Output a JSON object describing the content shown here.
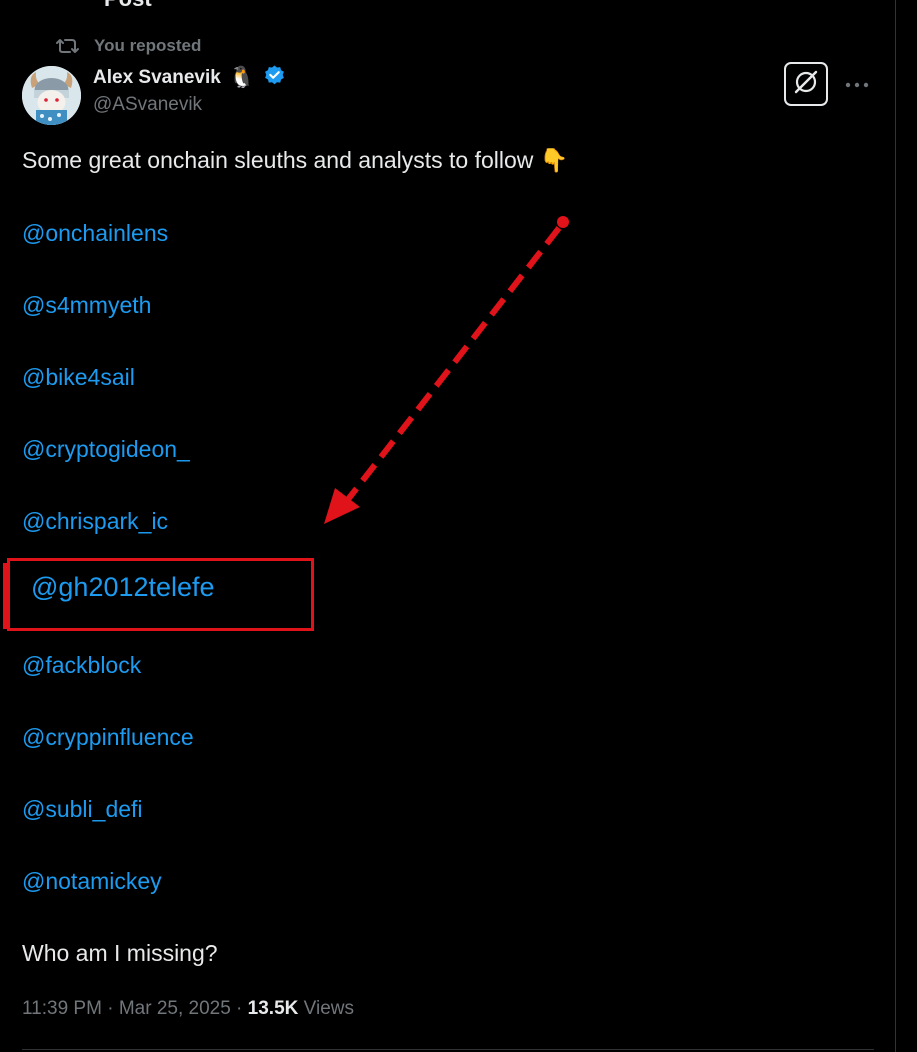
{
  "header": {
    "title": "Post"
  },
  "repost": {
    "label": "You reposted",
    "icon": "repost-icon"
  },
  "author": {
    "display_name": "Alex Svanevik",
    "emoji": "🐧",
    "verified": true,
    "handle": "@ASvanevik"
  },
  "actions": {
    "grok_icon": "grok-icon",
    "more_icon": "more-horizontal-icon"
  },
  "tweet": {
    "intro": "Some great onchain sleuths and analysts to follow 👇",
    "mentions": [
      "@onchainlens",
      "@s4mmyeth",
      "@bike4sail",
      "@cryptogideon_",
      "@chrispark_ic",
      "@gh2012telefe",
      "@fackblock",
      "@cryppinfluence",
      "@subli_defi",
      "@notamickey"
    ],
    "outro": "Who am I missing?"
  },
  "meta": {
    "time": "11:39 PM",
    "separator": " · ",
    "date": "Mar 25, 2025",
    "views_count": "13.5K",
    "views_label": "Views"
  },
  "colors": {
    "background": "#000000",
    "text": "#e7e9ea",
    "muted": "#71767b",
    "link": "#1d9bf0",
    "annotation_red": "#e0121a",
    "verified_blue": "#1d9bf0"
  }
}
